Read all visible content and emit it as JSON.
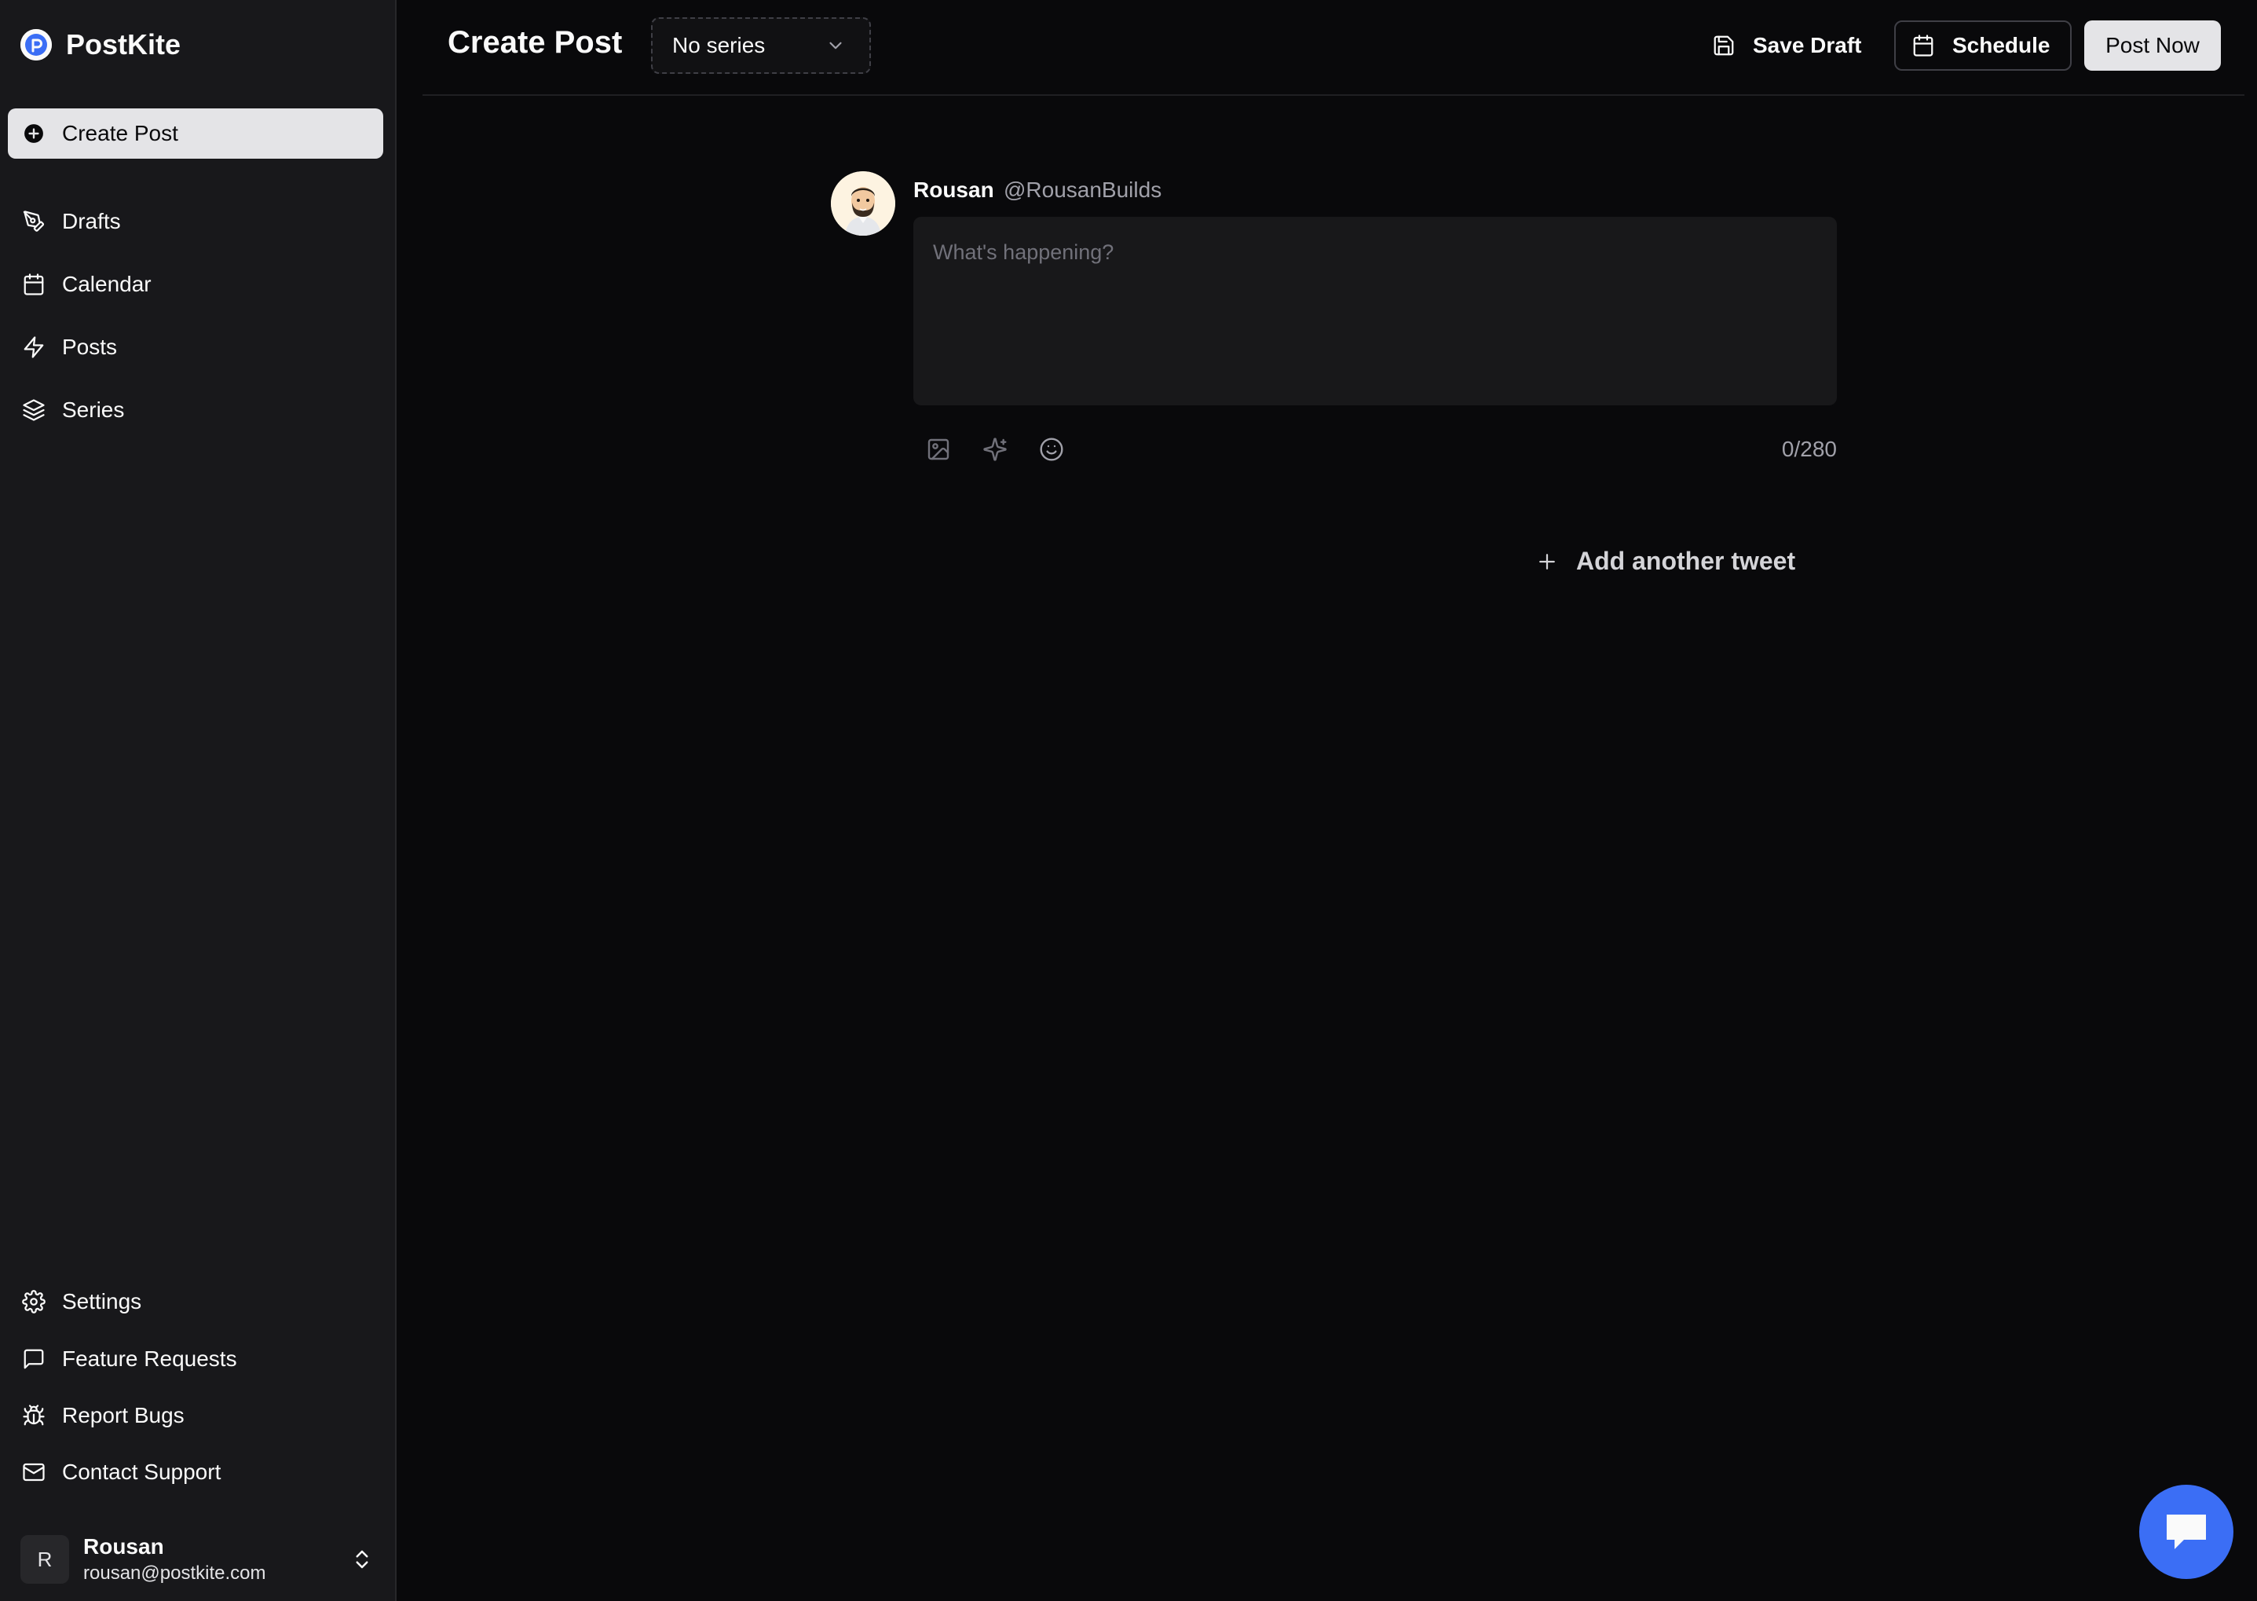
{
  "brand": {
    "name": "PostKite"
  },
  "sidebar": {
    "primary_action": "Create Post",
    "items": [
      {
        "label": "Drafts",
        "icon": "pen-tool-icon"
      },
      {
        "label": "Calendar",
        "icon": "calendar-icon"
      },
      {
        "label": "Posts",
        "icon": "zap-icon"
      },
      {
        "label": "Series",
        "icon": "layers-icon"
      }
    ],
    "bottom_items": [
      {
        "label": "Settings",
        "icon": "gear-icon"
      },
      {
        "label": "Feature Requests",
        "icon": "message-square-icon"
      },
      {
        "label": "Report Bugs",
        "icon": "bug-icon"
      },
      {
        "label": "Contact Support",
        "icon": "mail-icon"
      }
    ],
    "user": {
      "initial": "R",
      "name": "Rousan",
      "email": "rousan@postkite.com"
    }
  },
  "header": {
    "title": "Create Post",
    "series_select": {
      "value": "No series"
    },
    "save_draft_label": "Save Draft",
    "schedule_label": "Schedule",
    "post_now_label": "Post Now"
  },
  "composer": {
    "author_name": "Rousan",
    "author_handle": "@RousanBuilds",
    "placeholder": "What's happening?",
    "value": "",
    "char_count": "0/280",
    "add_another_label": "Add another tweet"
  },
  "colors": {
    "background": "#09090b",
    "sidebar": "#18181b",
    "active_item": "#e4e4e7",
    "chat_accent": "#3b6ef5"
  }
}
